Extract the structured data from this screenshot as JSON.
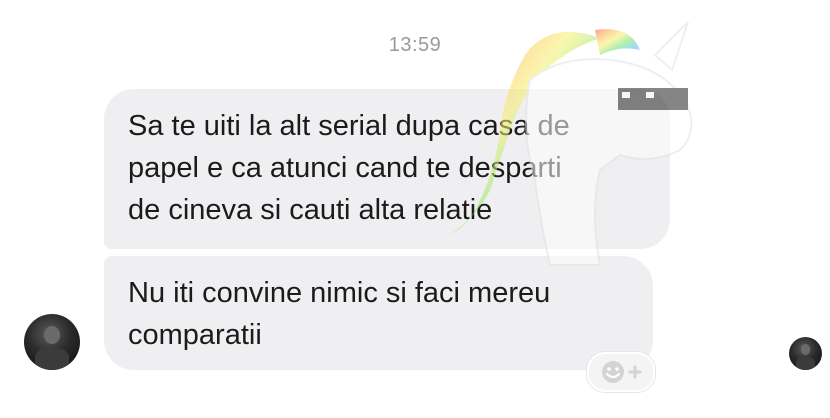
{
  "conversation": {
    "timestamp": "13:59",
    "messages": [
      {
        "lines": [
          "Sa te uiti la alt serial dupa casa de",
          "papel e ca atunci cand te desparti",
          "de cineva si cauti alta relatie"
        ]
      },
      {
        "lines": [
          "Nu iti convine nimic si faci mereu",
          "comparatii"
        ]
      }
    ]
  },
  "icons": {
    "reaction": "smiley-plus-icon",
    "watermark": "rainbow-unicorn-sunglasses-icon"
  },
  "colors": {
    "bubble": "#efeff1",
    "text": "#1b1b1b",
    "timestamp": "#9a9a9a",
    "background": "#ffffff"
  }
}
